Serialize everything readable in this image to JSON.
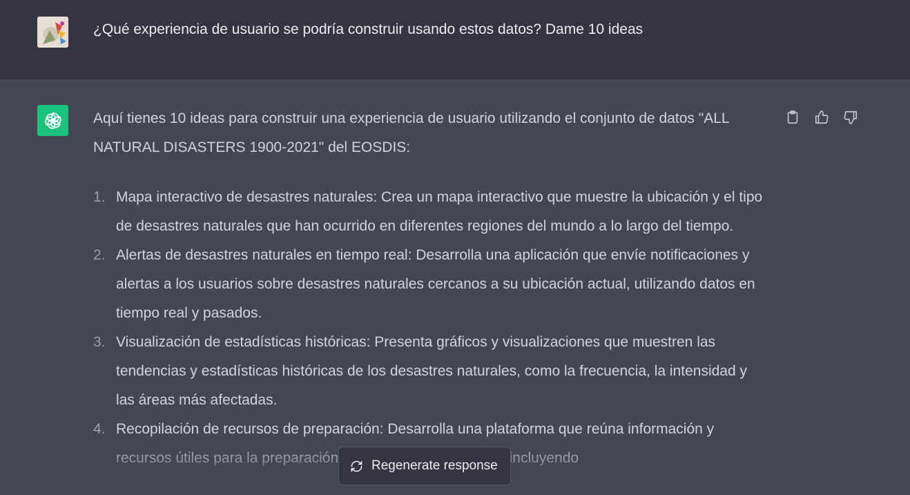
{
  "user_message": {
    "text": "¿Qué experiencia de usuario se podría construir usando estos datos? Dame 10 ideas"
  },
  "assistant_message": {
    "intro": "Aquí tienes 10 ideas para construir una experiencia de usuario utilizando el conjunto de datos \"ALL NATURAL DISASTERS 1900-2021\" del EOSDIS:",
    "items": [
      {
        "number": "1.",
        "text": "Mapa interactivo de desastres naturales: Crea un mapa interactivo que muestre la ubicación y el tipo de desastres naturales que han ocurrido en diferentes regiones del mundo a lo largo del tiempo."
      },
      {
        "number": "2.",
        "text": "Alertas de desastres naturales en tiempo real: Desarrolla una aplicación que envíe notificaciones y alertas a los usuarios sobre desastres naturales cercanos a su ubicación actual, utilizando datos en tiempo real y pasados."
      },
      {
        "number": "3.",
        "text": "Visualización de estadísticas históricas: Presenta gráficos y visualizaciones que muestren las tendencias y estadísticas históricas de los desastres naturales, como la frecuencia, la intensidad y las áreas más afectadas."
      },
      {
        "number": "4.",
        "text": "Recopilación de recursos de preparación: Desarrolla una plataforma que reúna información y recursos útiles para la preparación ante desastres naturales, incluyendo"
      }
    ]
  },
  "actions": {
    "copy_icon": "clipboard-icon",
    "like_icon": "thumbs-up-icon",
    "dislike_icon": "thumbs-down-icon"
  },
  "regenerate": {
    "label": "Regenerate response",
    "icon": "refresh-icon"
  },
  "colors": {
    "user_bg": "#343541",
    "assistant_bg": "#444654",
    "bot_avatar": "#19c37d"
  }
}
